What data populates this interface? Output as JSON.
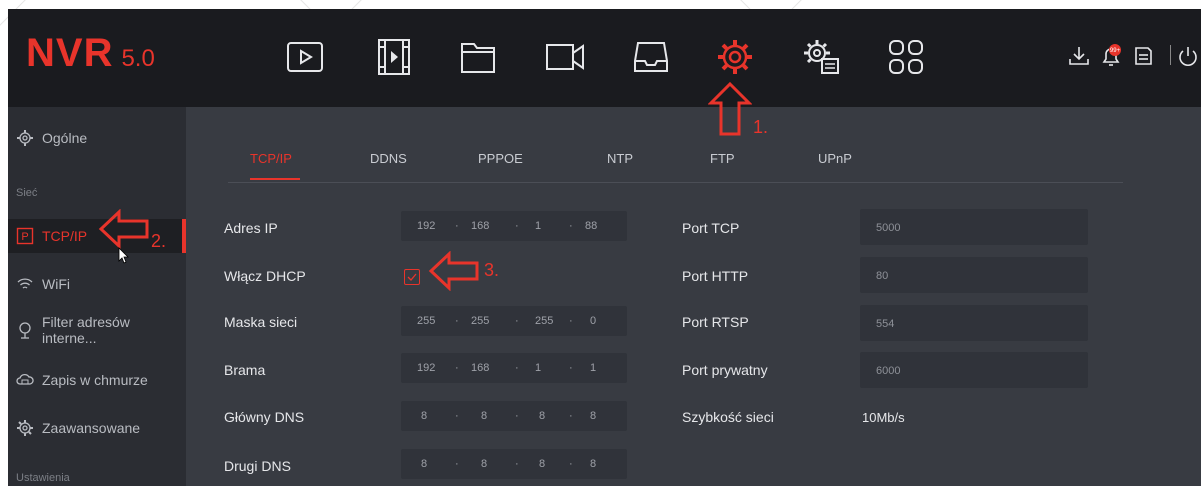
{
  "app": {
    "logo_main": "NVR",
    "logo_version": "5.0"
  },
  "toolbar": {
    "icons": [
      "play-icon",
      "playback-icon",
      "folder-icon",
      "camera-icon",
      "storage-icon",
      "settings-gear-icon",
      "system-settings-icon",
      "apps-grid-icon"
    ],
    "right_icons": [
      "download-icon",
      "alarm-icon",
      "backup-icon",
      "power-icon"
    ],
    "alarm_badge": "99+"
  },
  "sidebar": {
    "items": [
      {
        "label": "Ogólne",
        "icon": "general-gear-icon"
      },
      {
        "label": "TCP/IP",
        "icon": "network-p-icon"
      },
      {
        "label": "WiFi",
        "icon": "wifi-icon"
      },
      {
        "label": "Filter adresów interne...",
        "icon": "filter-pin-icon"
      },
      {
        "label": "Zapis w chmurze",
        "icon": "cloud-icon"
      },
      {
        "label": "Zaawansowane",
        "icon": "advanced-gear-icon"
      }
    ],
    "section_network": "Sieć",
    "section_settings": "Ustawienia"
  },
  "tabs": [
    "TCP/IP",
    "DDNS",
    "PPPOE",
    "NTP",
    "FTP",
    "UPnP"
  ],
  "form": {
    "ip_label": "Adres IP",
    "ip": [
      "192",
      "168",
      "1",
      "88"
    ],
    "dhcp_label": "Włącz DHCP",
    "mask_label": "Maska sieci",
    "mask": [
      "255",
      "255",
      "255",
      "0"
    ],
    "gateway_label": "Brama",
    "gateway": [
      "192",
      "168",
      "1",
      "1"
    ],
    "dns1_label": "Główny DNS",
    "dns1": [
      "8",
      "8",
      "8",
      "8"
    ],
    "dns2_label": "Drugi DNS",
    "dns2": [
      "8",
      "8",
      "8",
      "8"
    ],
    "port_tcp_label": "Port TCP",
    "port_tcp": "5000",
    "port_http_label": "Port HTTP",
    "port_http": "80",
    "port_rtsp_label": "Port RTSP",
    "port_rtsp": "554",
    "port_private_label": "Port prywatny",
    "port_private": "6000",
    "speed_label": "Szybkość sieci",
    "speed": "10Mb/s",
    "dot": "·"
  },
  "annotations": {
    "step1": "1.",
    "step2": "2.",
    "step3": "3."
  },
  "colors": {
    "accent": "#e8342b",
    "topbar": "#1a1b1f",
    "sidebar": "#2b2d33",
    "main": "#383b42",
    "input": "#30333a"
  }
}
